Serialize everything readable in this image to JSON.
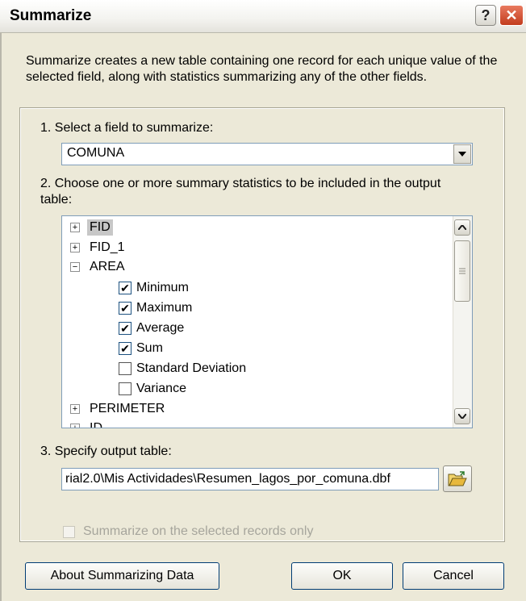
{
  "window": {
    "title": "Summarize",
    "help_label": "?",
    "close_label": "✕"
  },
  "intro_text": "Summarize creates a new table containing one record for each unique value of the selected field, along with statistics summarizing any of the other fields.",
  "step1": {
    "label": "1.  Select a field to summarize:",
    "value": "COMUNA"
  },
  "step2": {
    "label": "2.  Choose one or more summary statistics to be included in the output table:",
    "fields": [
      {
        "label": "FID",
        "expander": "+",
        "selected": true
      },
      {
        "label": "FID_1",
        "expander": "+"
      },
      {
        "label": "AREA",
        "expander": "−"
      },
      {
        "label": "PERIMETER",
        "expander": "+"
      },
      {
        "label": "ID",
        "expander": "+"
      }
    ],
    "statistics": [
      {
        "label": "Minimum",
        "checked": true,
        "mark": "✔"
      },
      {
        "label": "Maximum",
        "checked": true,
        "mark": "✔"
      },
      {
        "label": "Average",
        "checked": true,
        "mark": "✔"
      },
      {
        "label": "Sum",
        "checked": true,
        "mark": "✔"
      },
      {
        "label": "Standard Deviation",
        "checked": false,
        "mark": ""
      },
      {
        "label": "Variance",
        "checked": false,
        "mark": ""
      }
    ]
  },
  "step3": {
    "label": "3.  Specify output table:",
    "value": "rial2.0\\Mis Actividades\\Resumen_lagos_por_comuna.dbf"
  },
  "selected_only": {
    "label": "Summarize on the selected records only",
    "enabled": false
  },
  "buttons": {
    "about": "About Summarizing Data",
    "ok": "OK",
    "cancel": "Cancel"
  },
  "icons": {
    "combo": "chevron-down-icon",
    "folder": "open-folder-icon",
    "scroll_up": "scroll-up-icon",
    "scroll_down": "scroll-down-icon"
  }
}
